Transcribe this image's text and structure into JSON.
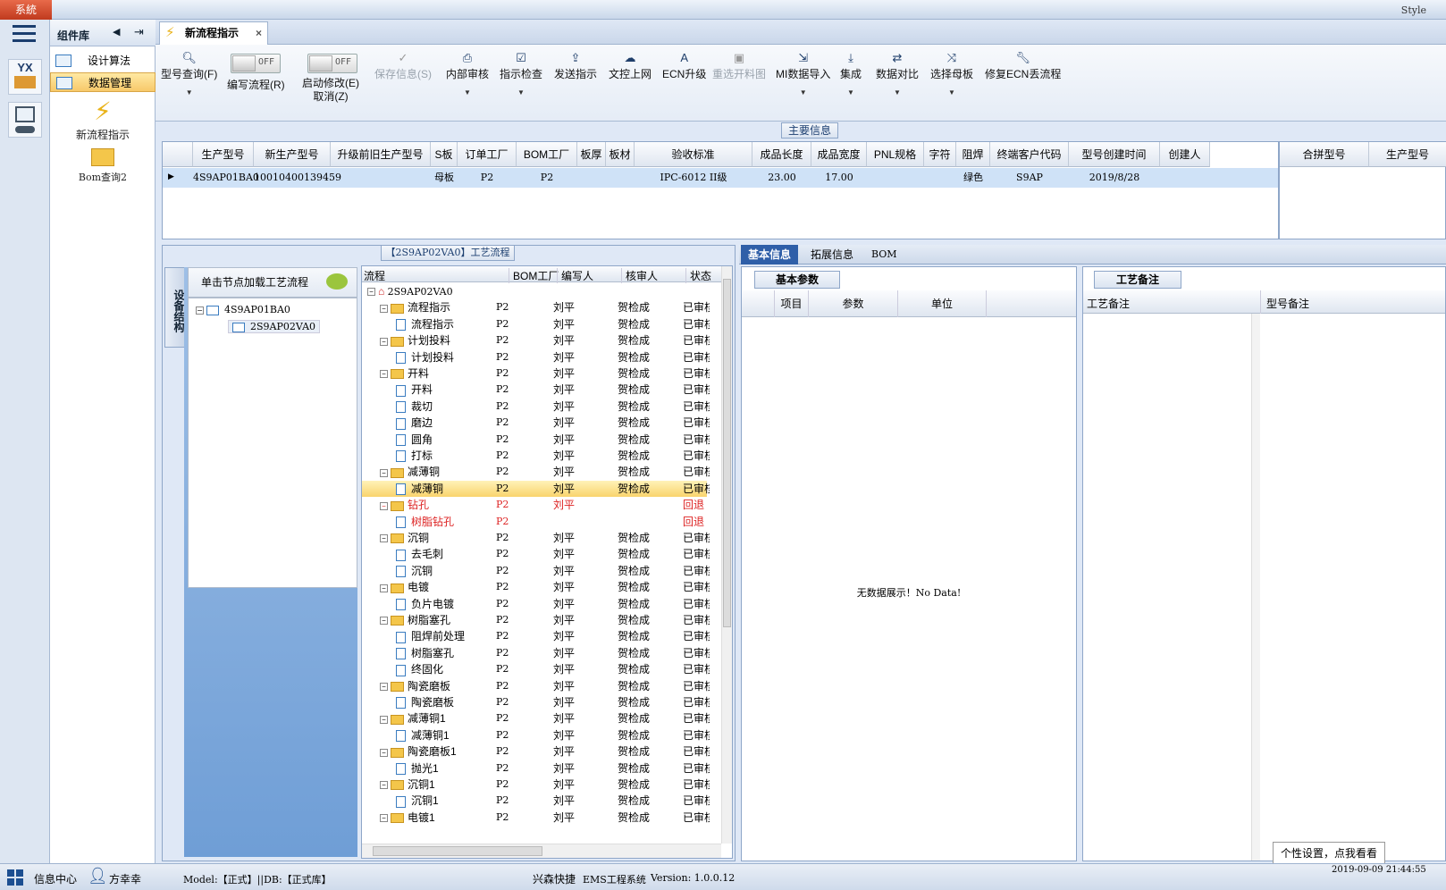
{
  "titlebar": {
    "system": "系統",
    "style": "Style"
  },
  "sidebar": {
    "complib_title": "组件库",
    "items": [
      {
        "label": "设计算法"
      },
      {
        "label": "数据管理"
      }
    ],
    "big_items": [
      {
        "label": "新流程指示"
      },
      {
        "label": "Bom查询2"
      }
    ],
    "yx": "YX"
  },
  "tab": {
    "title": "新流程指示"
  },
  "toolbar": {
    "query": "型号查询(F)",
    "edit_flow": "编写流程(R)",
    "start_modify": "启动修改(E)",
    "cancel": "取消(Z)",
    "off": "OFF",
    "save": "保存信息(S)",
    "internal": "内部审核",
    "check": "指示检查",
    "send": "发送指示",
    "upload": "文控上网",
    "ecn": "ECN升级",
    "reselect": "重选开料图",
    "mi_import": "MI数据导入",
    "integrate": "集成",
    "compare": "数据对比",
    "select_mother": "选择母板",
    "repair": "修复ECN丢流程"
  },
  "main_info": {
    "caption": "主要信息",
    "columns": [
      "生产型号",
      "新生产型号",
      "升级前旧生产型号",
      "S板",
      "订单工厂",
      "BOM工厂",
      "板厚",
      "板材",
      "验收标准",
      "成品长度",
      "成品宽度",
      "PNL规格",
      "字符",
      "阻焊",
      "终端客户代码",
      "型号创建时间",
      "创建人"
    ],
    "row": [
      "4S9AP01BA0",
      "10010400139459",
      "",
      "母板",
      "P2",
      "P2",
      "",
      "",
      "IPC-6012 II级",
      "23.00",
      "17.00",
      "",
      "",
      "绿色",
      "S9AP",
      "2019/8/28",
      ""
    ],
    "right_cols": [
      "合拼型号",
      "生产型号"
    ]
  },
  "flow": {
    "caption": "【2S9AP02VA0】工艺流程",
    "side_tab": "设备结构",
    "load_hint": "单击节点加载工艺流程",
    "nodes": [
      "4S9AP01BA0",
      "2S9AP02VA0"
    ],
    "cols": [
      "流程",
      "BOM工厂",
      "编写人",
      "核审人",
      "状态"
    ],
    "root": "2S9AP02VA0",
    "rows": [
      {
        "t": "流程指示",
        "lv": 1,
        "b": "P2",
        "w": "刘平",
        "r": "贺检成",
        "s": "已审核"
      },
      {
        "t": "流程指示",
        "lv": 2,
        "b": "P2",
        "w": "刘平",
        "r": "贺检成",
        "s": "已审核"
      },
      {
        "t": "计划投料",
        "lv": 1,
        "b": "P2",
        "w": "刘平",
        "r": "贺检成",
        "s": "已审核"
      },
      {
        "t": "计划投料",
        "lv": 2,
        "b": "P2",
        "w": "刘平",
        "r": "贺检成",
        "s": "已审核"
      },
      {
        "t": "开料",
        "lv": 1,
        "b": "P2",
        "w": "刘平",
        "r": "贺检成",
        "s": "已审核"
      },
      {
        "t": "开料",
        "lv": 2,
        "b": "P2",
        "w": "刘平",
        "r": "贺检成",
        "s": "已审核"
      },
      {
        "t": "裁切",
        "lv": 2,
        "b": "P2",
        "w": "刘平",
        "r": "贺检成",
        "s": "已审核"
      },
      {
        "t": "磨边",
        "lv": 2,
        "b": "P2",
        "w": "刘平",
        "r": "贺检成",
        "s": "已审核"
      },
      {
        "t": "圆角",
        "lv": 2,
        "b": "P2",
        "w": "刘平",
        "r": "贺检成",
        "s": "已审核"
      },
      {
        "t": "打标",
        "lv": 2,
        "b": "P2",
        "w": "刘平",
        "r": "贺检成",
        "s": "已审核"
      },
      {
        "t": "减薄铜",
        "lv": 1,
        "b": "P2",
        "w": "刘平",
        "r": "贺检成",
        "s": "已审核"
      },
      {
        "t": "减薄铜",
        "lv": 2,
        "b": "P2",
        "w": "刘平",
        "r": "贺检成",
        "s": "已审核",
        "sel": true
      },
      {
        "t": "钻孔",
        "lv": 1,
        "b": "P2",
        "w": "刘平",
        "r": "",
        "s": "回退",
        "red": true
      },
      {
        "t": "树脂钻孔",
        "lv": 2,
        "b": "P2",
        "w": "",
        "r": "",
        "s": "回退",
        "red": true
      },
      {
        "t": "沉铜",
        "lv": 1,
        "b": "P2",
        "w": "刘平",
        "r": "贺检成",
        "s": "已审核"
      },
      {
        "t": "去毛刺",
        "lv": 2,
        "b": "P2",
        "w": "刘平",
        "r": "贺检成",
        "s": "已审核"
      },
      {
        "t": "沉铜",
        "lv": 2,
        "b": "P2",
        "w": "刘平",
        "r": "贺检成",
        "s": "已审核"
      },
      {
        "t": "电镀",
        "lv": 1,
        "b": "P2",
        "w": "刘平",
        "r": "贺检成",
        "s": "已审核"
      },
      {
        "t": "负片电镀",
        "lv": 2,
        "b": "P2",
        "w": "刘平",
        "r": "贺检成",
        "s": "已审核"
      },
      {
        "t": "树脂塞孔",
        "lv": 1,
        "b": "P2",
        "w": "刘平",
        "r": "贺检成",
        "s": "已审核"
      },
      {
        "t": "阻焊前处理",
        "lv": 2,
        "b": "P2",
        "w": "刘平",
        "r": "贺检成",
        "s": "已审核"
      },
      {
        "t": "树脂塞孔",
        "lv": 2,
        "b": "P2",
        "w": "刘平",
        "r": "贺检成",
        "s": "已审核"
      },
      {
        "t": "终固化",
        "lv": 2,
        "b": "P2",
        "w": "刘平",
        "r": "贺检成",
        "s": "已审核"
      },
      {
        "t": "陶瓷磨板",
        "lv": 1,
        "b": "P2",
        "w": "刘平",
        "r": "贺检成",
        "s": "已审核"
      },
      {
        "t": "陶瓷磨板",
        "lv": 2,
        "b": "P2",
        "w": "刘平",
        "r": "贺检成",
        "s": "已审核"
      },
      {
        "t": "减薄铜1",
        "lv": 1,
        "b": "P2",
        "w": "刘平",
        "r": "贺检成",
        "s": "已审核"
      },
      {
        "t": "减薄铜1",
        "lv": 2,
        "b": "P2",
        "w": "刘平",
        "r": "贺检成",
        "s": "已审核"
      },
      {
        "t": "陶瓷磨板1",
        "lv": 1,
        "b": "P2",
        "w": "刘平",
        "r": "贺检成",
        "s": "已审核"
      },
      {
        "t": "抛光1",
        "lv": 2,
        "b": "P2",
        "w": "刘平",
        "r": "贺检成",
        "s": "已审核"
      },
      {
        "t": "沉铜1",
        "lv": 1,
        "b": "P2",
        "w": "刘平",
        "r": "贺检成",
        "s": "已审核"
      },
      {
        "t": "沉铜1",
        "lv": 2,
        "b": "P2",
        "w": "刘平",
        "r": "贺检成",
        "s": "已审核"
      },
      {
        "t": "电镀1",
        "lv": 1,
        "b": "P2",
        "w": "刘平",
        "r": "贺检成",
        "s": "已审核"
      }
    ]
  },
  "detail": {
    "tabs": [
      "基本信息",
      "拓展信息",
      "BOM"
    ],
    "basic_params": "基本参数",
    "cols": [
      "项目",
      "参数",
      "单位"
    ],
    "nodata": "无数据展示！No Data!"
  },
  "craft": {
    "title": "工艺备注",
    "cols": [
      "工艺备注",
      "型号备注"
    ]
  },
  "status": {
    "info_center": "信息中心",
    "user": "方幸幸",
    "model": "Model:【正式】||DB:【正式库】",
    "company": "兴森快捷",
    "system": "EMS工程系统",
    "version": "Version: 1.0.0.12",
    "tip": "个性设置，点我看看",
    "datetime": "2019-09-09 21:44:55"
  }
}
